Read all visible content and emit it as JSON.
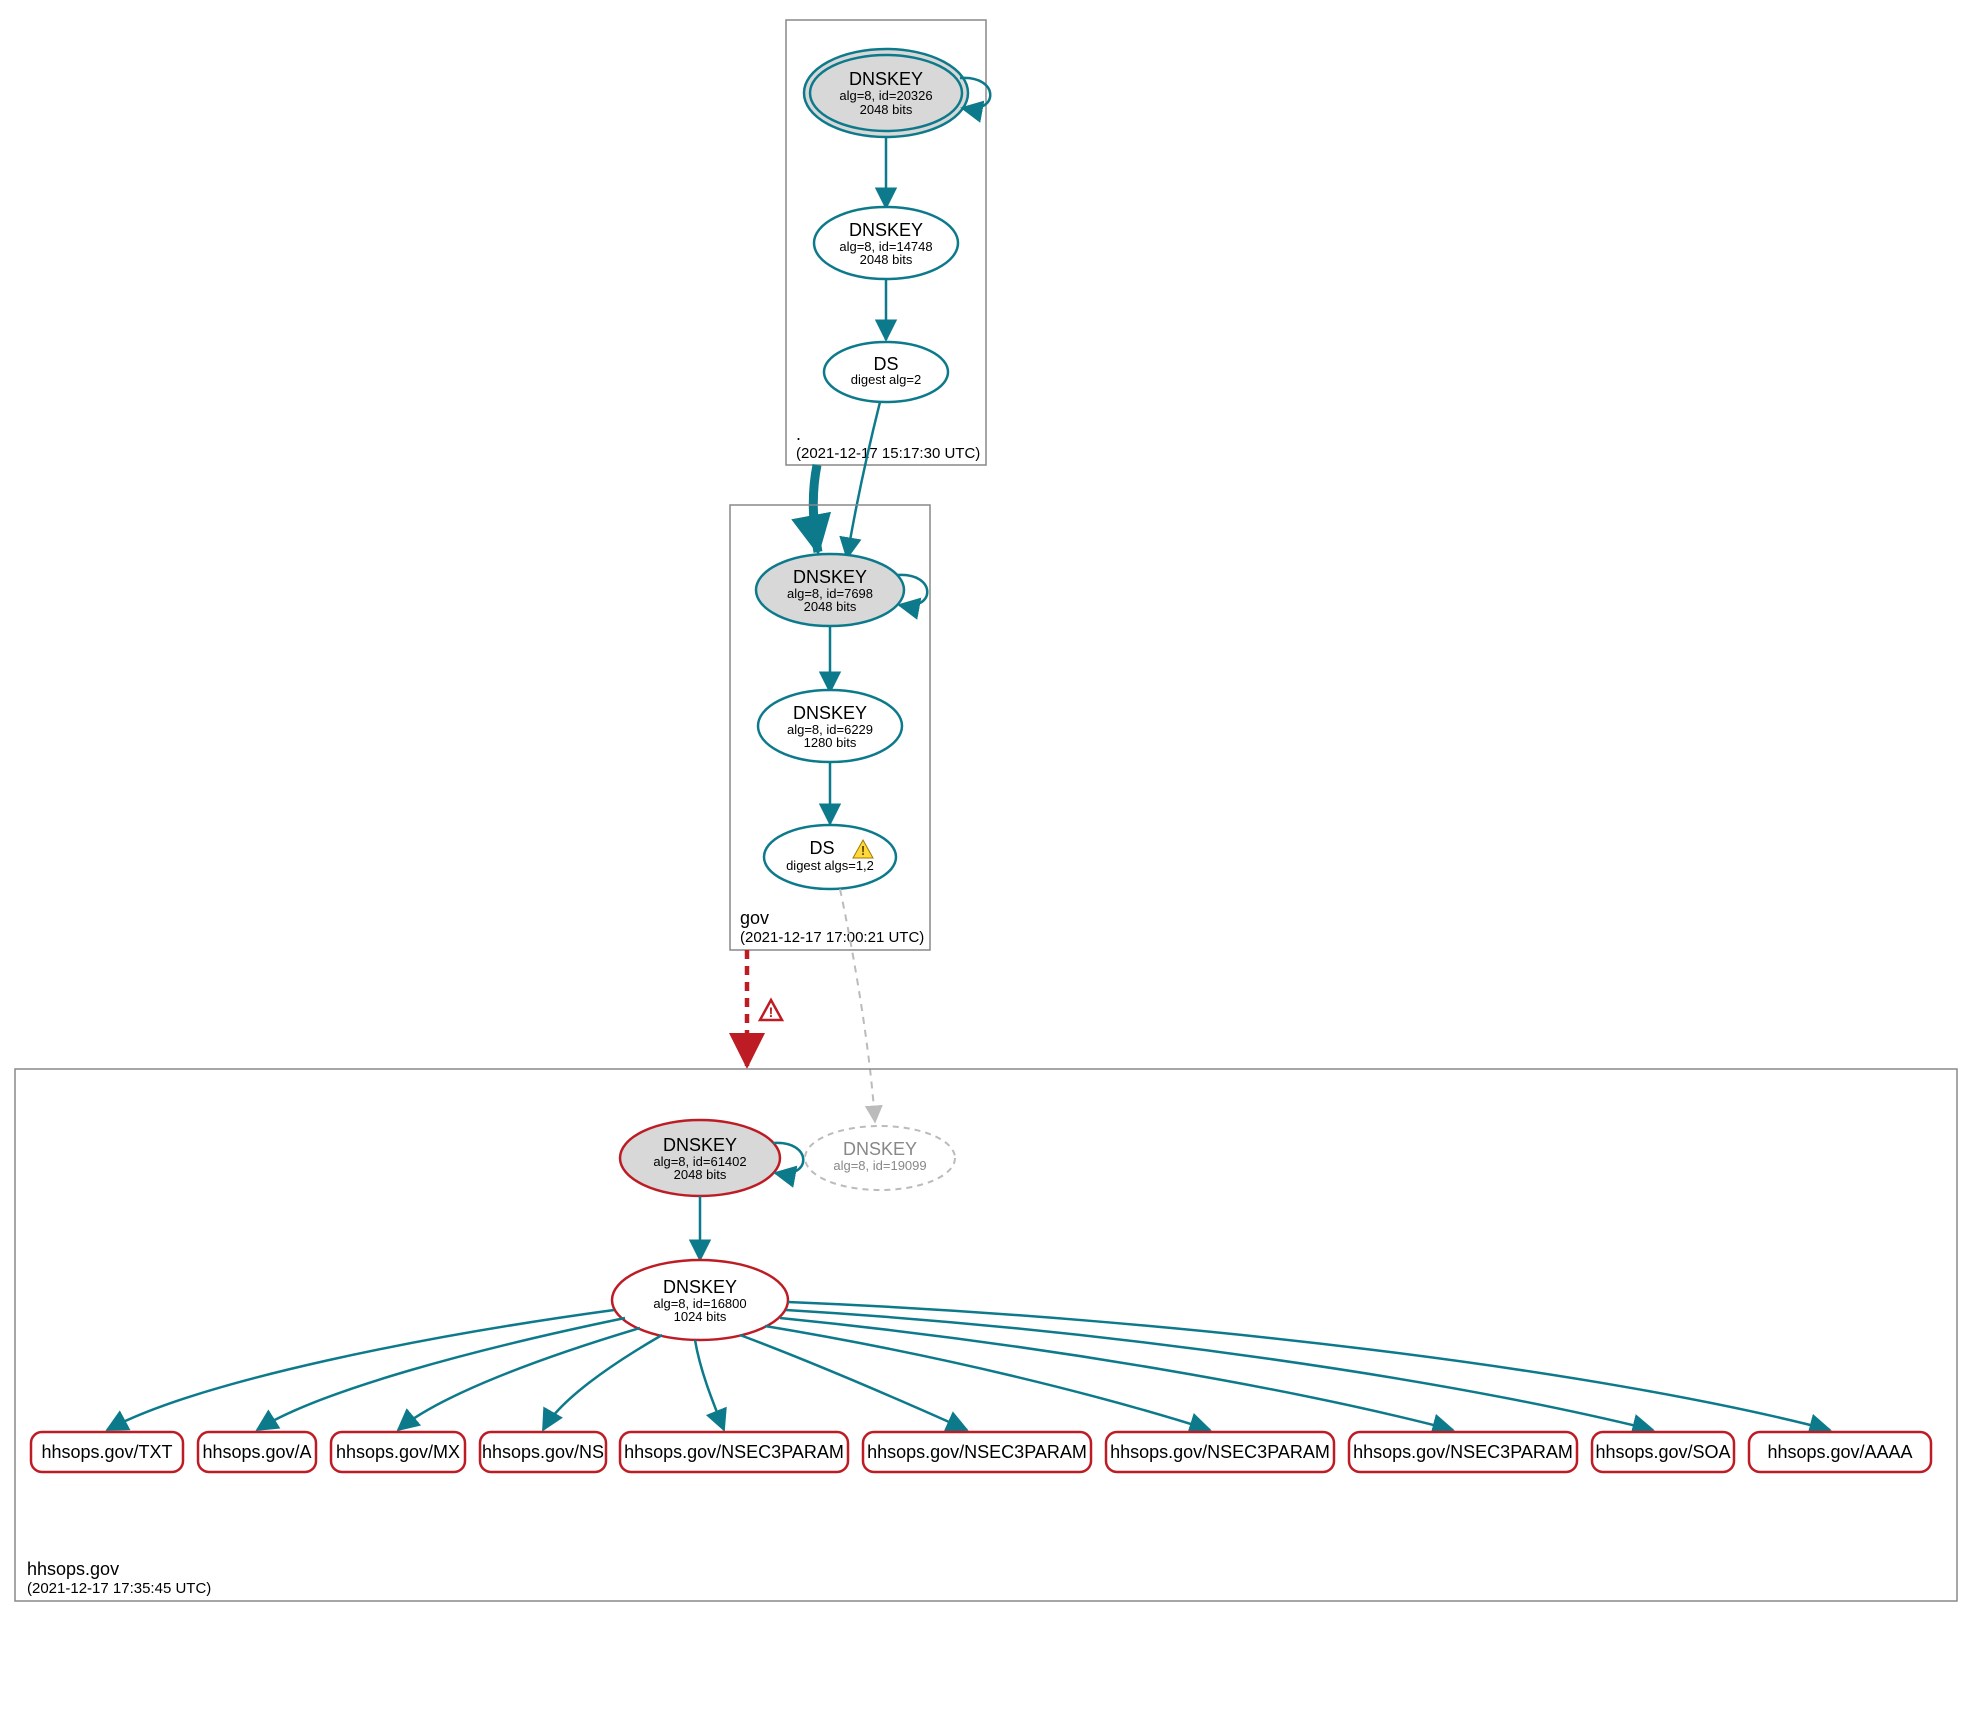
{
  "zones": {
    "root": {
      "label": ".",
      "timestamp": "(2021-12-17 15:17:30 UTC)",
      "nodes": {
        "k20326": {
          "title": "DNSKEY",
          "l2": "alg=8, id=20326",
          "l3": "2048 bits"
        },
        "k14748": {
          "title": "DNSKEY",
          "l2": "alg=8, id=14748",
          "l3": "2048 bits"
        },
        "ds2": {
          "title": "DS",
          "l2": "digest alg=2"
        }
      }
    },
    "gov": {
      "label": "gov",
      "timestamp": "(2021-12-17 17:00:21 UTC)",
      "nodes": {
        "k7698": {
          "title": "DNSKEY",
          "l2": "alg=8, id=7698",
          "l3": "2048 bits"
        },
        "k6229": {
          "title": "DNSKEY",
          "l2": "alg=8, id=6229",
          "l3": "1280 bits"
        },
        "ds12": {
          "title": "DS",
          "l2": "digest algs=1,2"
        }
      }
    },
    "hhsops": {
      "label": "hhsops.gov",
      "timestamp": "(2021-12-17 17:35:45 UTC)",
      "nodes": {
        "k61402": {
          "title": "DNSKEY",
          "l2": "alg=8, id=61402",
          "l3": "2048 bits"
        },
        "k16800": {
          "title": "DNSKEY",
          "l2": "alg=8, id=16800",
          "l3": "1024 bits"
        },
        "k19099": {
          "title": "DNSKEY",
          "l2": "alg=8, id=19099"
        }
      },
      "rrsets": [
        "hhsops.gov/TXT",
        "hhsops.gov/A",
        "hhsops.gov/MX",
        "hhsops.gov/NS",
        "hhsops.gov/NSEC3PARAM",
        "hhsops.gov/NSEC3PARAM",
        "hhsops.gov/NSEC3PARAM",
        "hhsops.gov/NSEC3PARAM",
        "hhsops.gov/SOA",
        "hhsops.gov/AAAA"
      ]
    }
  },
  "colors": {
    "teal": "#0d7a8b",
    "red": "#be1c24",
    "grey": "#bbb",
    "sep": "#d8d8d8"
  }
}
